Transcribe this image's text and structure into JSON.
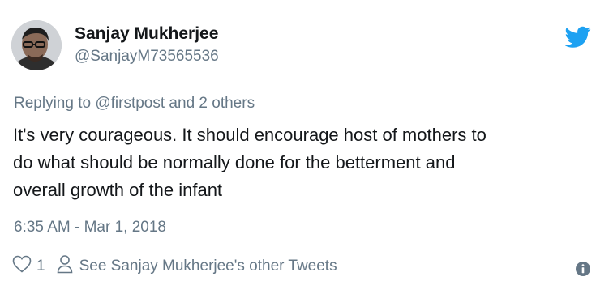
{
  "tweet": {
    "author": {
      "name": "Sanjay Mukherjee",
      "handle": "@SanjayM73565536"
    },
    "replying": {
      "prefix": "Replying to ",
      "mention": "@firstpost",
      "suffix": " and 2 others"
    },
    "body_lines": [
      "It's very courageous. It should encourage host of mothers to",
      "do what should be normally done for the betterment and",
      "overall growth of the infant"
    ],
    "timestamp": "6:35 AM - Mar 1, 2018",
    "likes": "1",
    "other_tweets_link": "See Sanjay Mukherjee's other Tweets"
  },
  "colors": {
    "brand": "#1da1f2",
    "text": "#14171a",
    "muted": "#657786"
  },
  "icons": {
    "brand": "twitter-bird-icon",
    "like": "heart-outline-icon",
    "profile": "person-icon",
    "info": "info-icon"
  }
}
